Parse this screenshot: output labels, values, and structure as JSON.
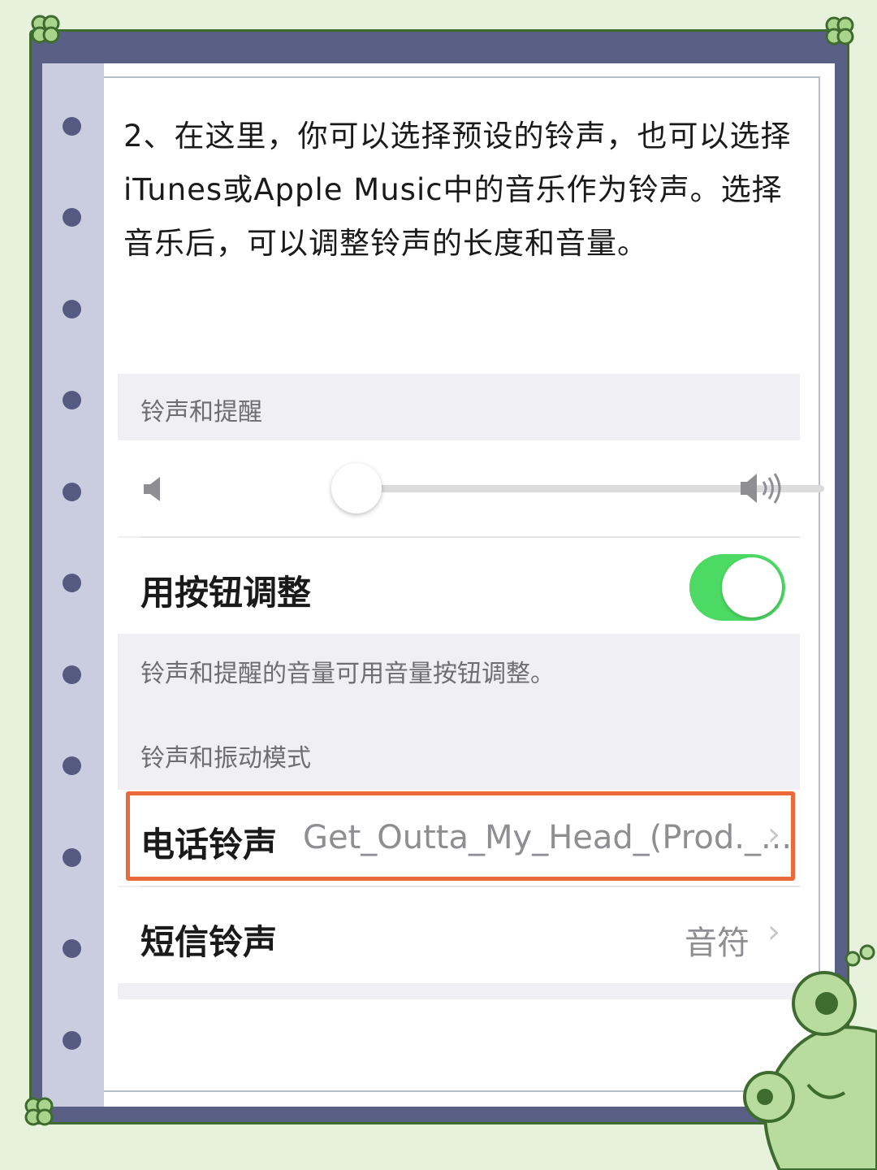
{
  "intro": {
    "text": "2、在这里，你可以选择预设的铃声，也可以选择iTunes或Apple Music中的音乐作为铃声。选择音乐后，可以调整铃声的长度和音量。"
  },
  "settings": {
    "header_ringer": "铃声和提醒",
    "volume_level": 0.04,
    "volume_icon_low": "speaker-low-icon",
    "volume_icon_high": "speaker-high-icon",
    "button_adjust_label": "用按钮调整",
    "button_adjust_on": true,
    "footer_note": "铃声和提醒的音量可用音量按钮调整。",
    "header_patterns": "铃声和振动模式",
    "ringtone_label": "电话铃声",
    "ringtone_value": "Get_Outta_My_Head_(Prod._...",
    "sms_label": "短信铃声",
    "sms_value": "音符",
    "chevron": "›"
  },
  "colors": {
    "frame": "#5a5f86",
    "background": "#e6f2dc",
    "toggle_on": "#4cd964",
    "highlight": "#ea6a3b"
  }
}
